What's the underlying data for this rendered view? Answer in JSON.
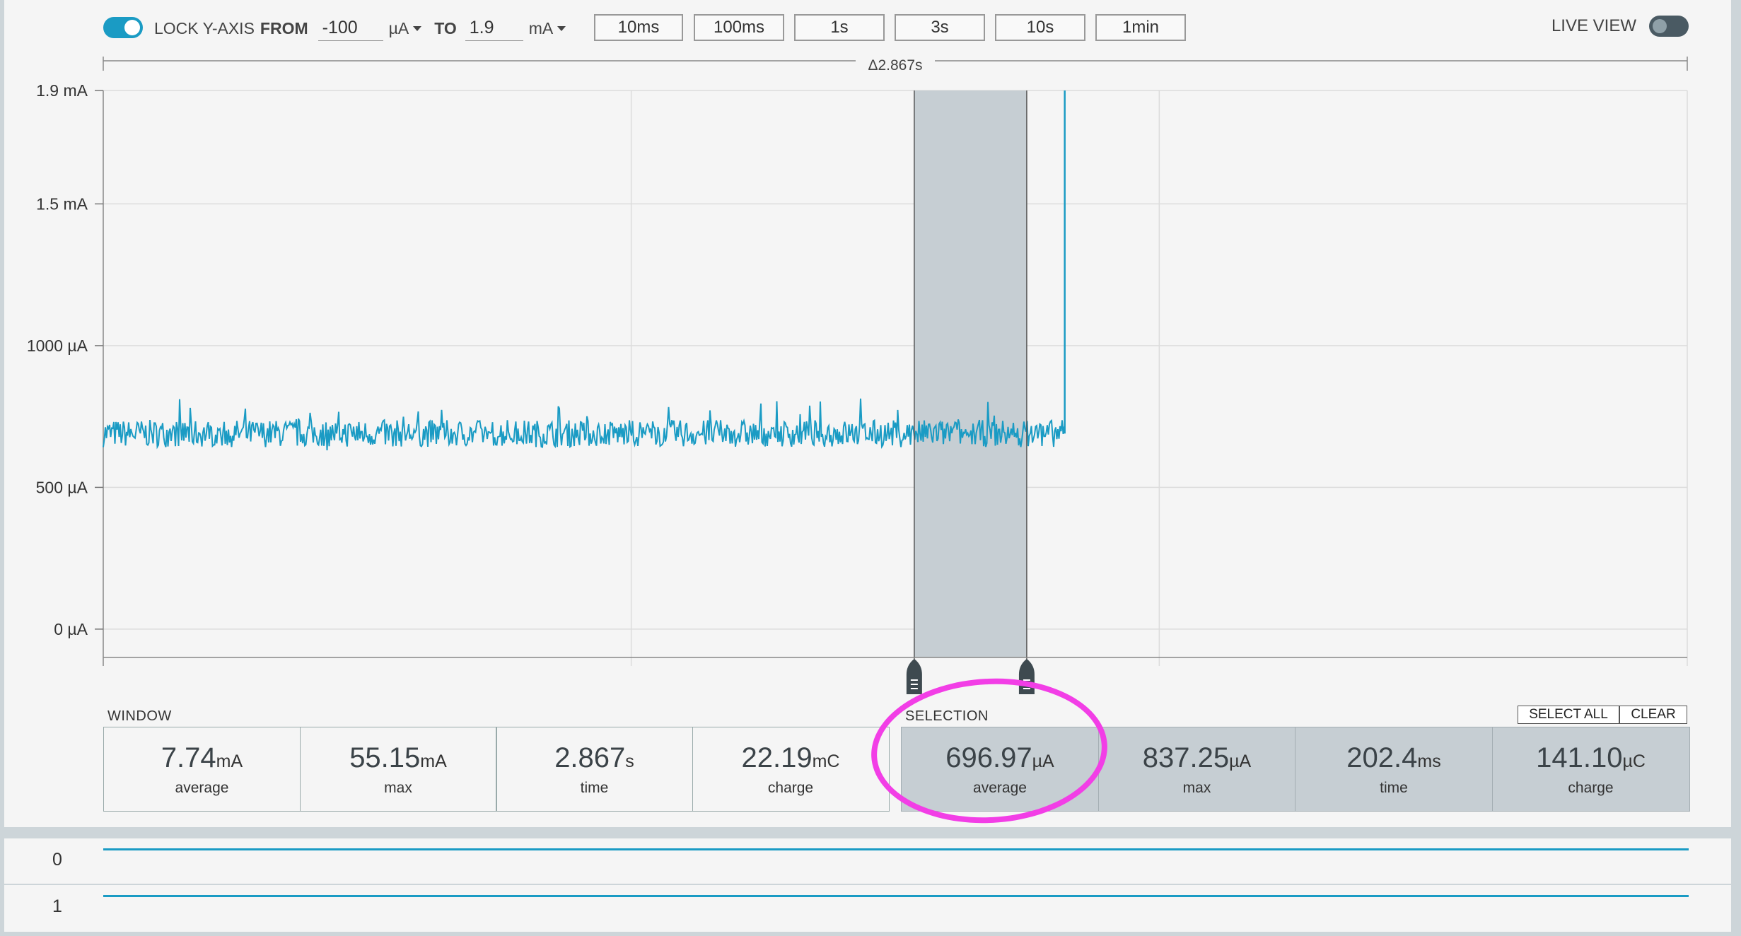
{
  "toolbar": {
    "lock_label": "LOCK Y-AXIS",
    "from_label": "FROM",
    "from_value": "-100",
    "from_unit": "µA",
    "to_label": "TO",
    "to_value": "1.9",
    "to_unit": "mA",
    "timebuttons": [
      "10ms",
      "100ms",
      "1s",
      "3s",
      "10s",
      "1min"
    ],
    "live_view_label": "LIVE VIEW"
  },
  "colors": {
    "accent": "#1a9bc4",
    "highlight": "#f23ee6",
    "selection_fill": "#c6ced3"
  },
  "chart_data": {
    "type": "line",
    "delta_label": "Δ2.867s",
    "y_ticks": [
      "1.9 mA",
      "1.5 mA",
      "1000 µA",
      "500 µA",
      "0 µA"
    ],
    "y_tick_values_uA": [
      1900,
      1500,
      1000,
      500,
      0
    ],
    "ylim_uA": [
      -100,
      1900
    ],
    "series_mean_uA": 690,
    "series_noise_uA": 60,
    "window_duration_s": 2.867,
    "selection_window_fraction": [
      0.512,
      0.583
    ],
    "trace_end_fraction": 0.607,
    "grid": true
  },
  "window": {
    "title": "WINDOW",
    "stats": [
      {
        "value": "7.74",
        "unit": "mA",
        "label": "average"
      },
      {
        "value": "55.15",
        "unit": "mA",
        "label": "max"
      },
      {
        "value": "2.867",
        "unit": "s",
        "label": "time"
      },
      {
        "value": "22.19",
        "unit": "mC",
        "label": "charge"
      }
    ]
  },
  "selection": {
    "title": "SELECTION",
    "select_all": "SELECT ALL",
    "clear": "CLEAR",
    "stats": [
      {
        "value": "696.97",
        "unit": "µA",
        "label": "average"
      },
      {
        "value": "837.25",
        "unit": "µA",
        "label": "max"
      },
      {
        "value": "202.4",
        "unit": "ms",
        "label": "time"
      },
      {
        "value": "141.10",
        "unit": "µC",
        "label": "charge"
      }
    ]
  },
  "digital_channels": [
    {
      "label": "0"
    },
    {
      "label": "1"
    }
  ]
}
